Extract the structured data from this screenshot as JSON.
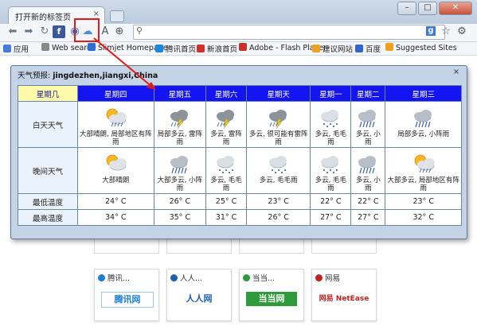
{
  "browser": {
    "tab_title": "打开新的标签页",
    "tab_close": "×",
    "win_buttons": [
      "–",
      "□",
      "✕"
    ]
  },
  "bookmarks": [
    {
      "label": "应用",
      "color": "#4a7bd6"
    },
    {
      "label": "Web search",
      "color": "#888888"
    },
    {
      "label": "Slimjet Homepage",
      "color": "#2b6fd1"
    },
    {
      "label": "腾讯首页",
      "color": "#1a88e0"
    },
    {
      "label": "新浪首页",
      "color": "#d62d2d"
    },
    {
      "label": "Adobe - Flash Player",
      "color": "#c9302c"
    },
    {
      "label": "建议网站",
      "color": "#f0a020"
    },
    {
      "label": "百度",
      "color": "#3366cc"
    },
    {
      "label": "Suggested Sites",
      "color": "#f0a020"
    }
  ],
  "weather": {
    "title_prefix": "天气预报:",
    "location": "jingdezhen,jiangxi,China",
    "close": "×",
    "header_first": "星期几",
    "days": [
      "星期四",
      "星期五",
      "星期六",
      "星期天",
      "星期一",
      "星期二",
      "星期三"
    ],
    "day_label": "白天天气",
    "night_label": "晚间天气",
    "low_label": "最低温度",
    "high_label": "最高温度",
    "day_conditions": [
      {
        "text": "大部晴朗, 局部地区有阵雨",
        "icon": "sun-cloud-rain-icon"
      },
      {
        "text": "局部多云, 雷阵雨",
        "icon": "thunderstorm-icon"
      },
      {
        "text": "多云, 雷阵雨",
        "icon": "thunderstorm-icon"
      },
      {
        "text": "多云, 很可能有雷阵雨",
        "icon": "thunderstorm-icon"
      },
      {
        "text": "多云, 毛毛雨",
        "icon": "drizzle-icon"
      },
      {
        "text": "多云, 小雨",
        "icon": "rain-icon"
      },
      {
        "text": "局部多云, 小阵雨",
        "icon": "rain-icon"
      }
    ],
    "night_conditions": [
      {
        "text": "大部晴朗",
        "icon": "partly-cloudy-icon"
      },
      {
        "text": "大部多云, 小阵雨",
        "icon": "rain-icon"
      },
      {
        "text": "多云, 毛毛雨",
        "icon": "drizzle-icon"
      },
      {
        "text": "多云, 毛毛雨",
        "icon": "drizzle-icon"
      },
      {
        "text": "多云, 毛毛雨",
        "icon": "drizzle-icon"
      },
      {
        "text": "多云, 小雨",
        "icon": "rain-icon"
      },
      {
        "text": "大部多云, 局部地区有阵雨",
        "icon": "sun-cloud-rain-icon"
      }
    ],
    "low_temps": [
      "24° C",
      "26° C",
      "25° C",
      "23° C",
      "22° C",
      "22° C",
      "23° C"
    ],
    "high_temps": [
      "34° C",
      "35° C",
      "31° C",
      "26° C",
      "27° C",
      "27° C",
      "32° C"
    ]
  },
  "tiles": [
    {
      "title": "腾讯...",
      "logo": "腾讯网",
      "logo_color": "#1a7fd6",
      "dot": "#1a7fd6"
    },
    {
      "title": "人人...",
      "logo": "人人网",
      "logo_color": "#1f5fae",
      "dot": "#1f5fae"
    },
    {
      "title": "当当...",
      "logo": "当当网",
      "logo_color": "#2e9b3a",
      "dot": "#2e9b3a"
    },
    {
      "title": "网易",
      "logo": "网易 NetEase",
      "logo_color": "#c72020",
      "dot": "#c72020"
    }
  ],
  "colors": {
    "header_blue": "#1414f0",
    "header_first_bg": "#fffaaa",
    "highlight_red": "#e21a1a"
  }
}
